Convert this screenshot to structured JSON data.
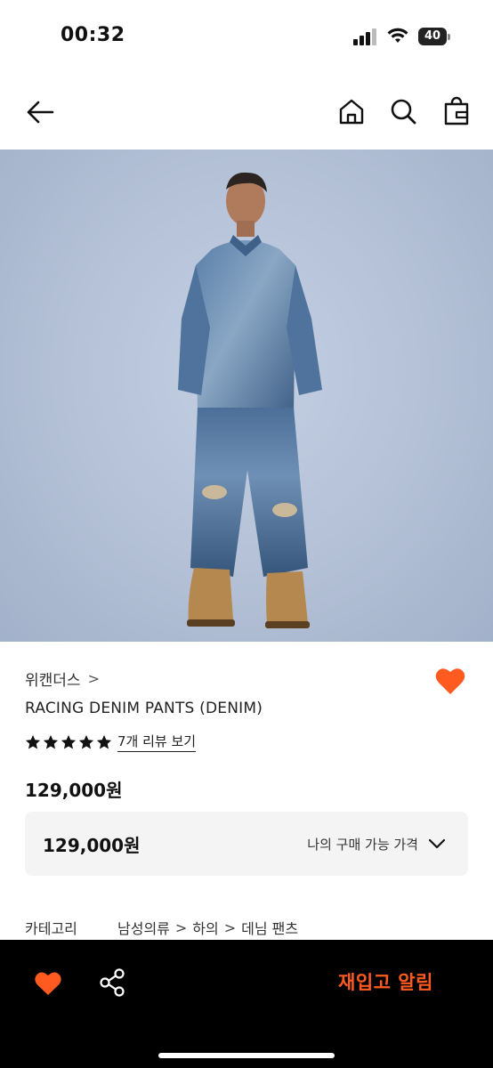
{
  "status_bar": {
    "time": "00:32",
    "battery": "40",
    "icons": [
      "signal-icon",
      "wifi-icon",
      "battery-icon"
    ]
  },
  "nav": {
    "icons": [
      "back-arrow-icon",
      "home-icon",
      "search-icon",
      "shopping-bag-icon"
    ]
  },
  "product": {
    "image_alt": "model-wearing-denim-shirt-and-pants",
    "brand": "위캔더스",
    "brand_chevron": ">",
    "name": "RACING DENIM PANTS (DENIM)",
    "rating": 5,
    "review_link": "7개 리뷰 보기",
    "price": "129,000원",
    "price_box": {
      "value": "129,000원",
      "label": "나의 구매 가능 가격"
    },
    "category": {
      "label": "카테고리",
      "path": [
        "남성의류",
        "하의",
        "데님 팬츠"
      ],
      "separator": ">"
    }
  },
  "bottom_bar": {
    "restock_label": "재입고 알림",
    "icons": [
      "heart-icon",
      "share-icon"
    ]
  },
  "colors": {
    "accent": "#ff5a1f",
    "bottom_bar_bg": "#000000",
    "price_box_bg": "#f4f4f4"
  }
}
